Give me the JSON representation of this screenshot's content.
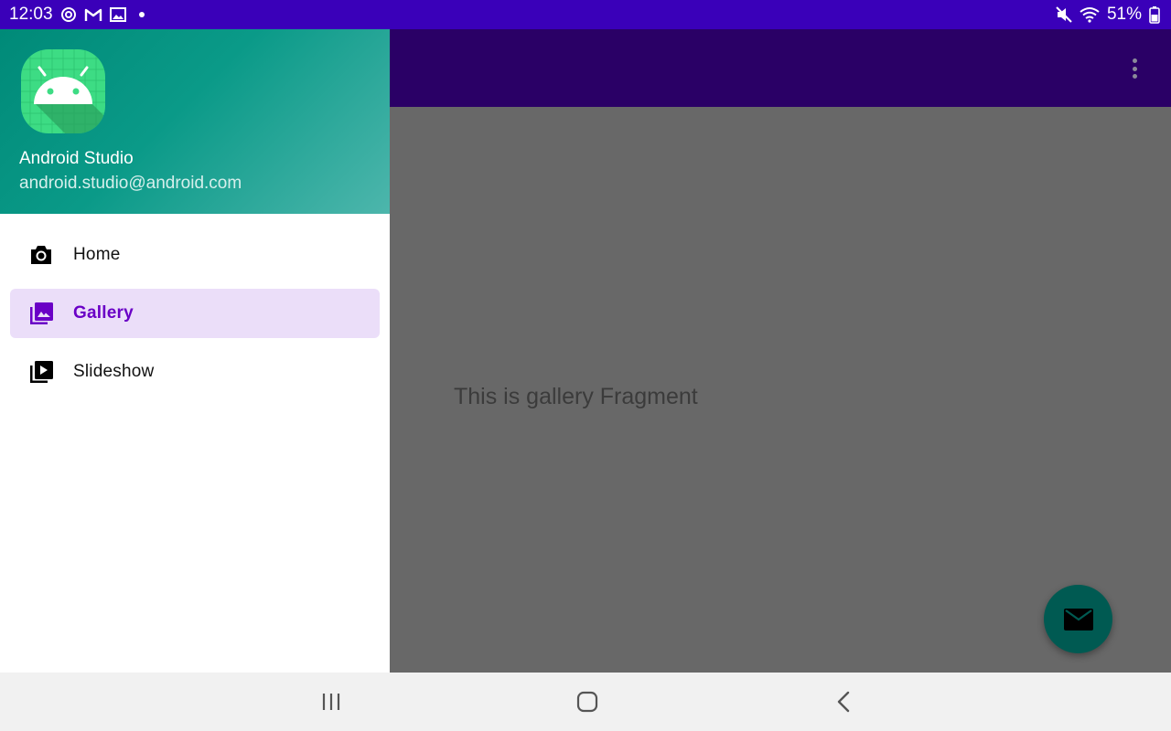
{
  "status_bar": {
    "time": "12:03",
    "left_icons": [
      "sync-icon",
      "gmail-icon",
      "image-icon",
      "notification-dot"
    ],
    "right_icons": [
      "mute-icon",
      "wifi-icon",
      "battery-icon"
    ],
    "battery_text": "51%"
  },
  "drawer": {
    "header": {
      "app_name": "Android Studio",
      "email": "android.studio@android.com",
      "logo_icon": "android-logo-icon"
    },
    "items": [
      {
        "label": "Home",
        "icon": "camera-icon",
        "selected": false
      },
      {
        "label": "Gallery",
        "icon": "gallery-icon",
        "selected": true
      },
      {
        "label": "Slideshow",
        "icon": "slideshow-icon",
        "selected": false
      }
    ]
  },
  "app_bar": {
    "overflow_icon": "more-vert-icon"
  },
  "content": {
    "text": "This is gallery Fragment"
  },
  "fab": {
    "icon": "mail-icon"
  },
  "system_nav": {
    "buttons": [
      "recents-icon",
      "home-icon",
      "back-icon"
    ]
  },
  "colors": {
    "status_bar": "#3a00b9",
    "app_bar": "#2a0066",
    "drawer_header_start": "#008a78",
    "drawer_header_end": "#4db6ac",
    "selected_bg": "#ebdef9",
    "selected_text": "#6a00c6",
    "fab": "#005a52",
    "scrim_content": "#686868"
  }
}
